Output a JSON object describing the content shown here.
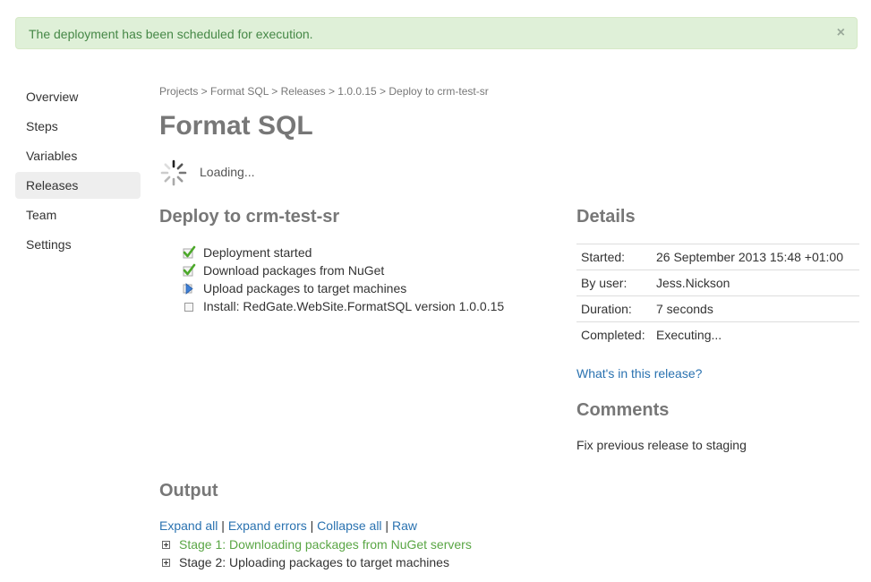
{
  "alert": {
    "message": "The deployment has been scheduled for execution.",
    "close": "×"
  },
  "sidebar": {
    "items": [
      {
        "label": "Overview",
        "active": false
      },
      {
        "label": "Steps",
        "active": false
      },
      {
        "label": "Variables",
        "active": false
      },
      {
        "label": "Releases",
        "active": true
      },
      {
        "label": "Team",
        "active": false
      },
      {
        "label": "Settings",
        "active": false
      }
    ]
  },
  "breadcrumb": "Projects > Format SQL > Releases > 1.0.0.15 > Deploy to crm-test-sr",
  "title": "Format SQL",
  "loading": "Loading...",
  "deploy": {
    "heading": "Deploy to crm-test-sr",
    "steps": [
      {
        "icon": "check-icon",
        "label": "Deployment started"
      },
      {
        "icon": "check-icon",
        "label": "Download packages from NuGet"
      },
      {
        "icon": "arrow-right-icon",
        "label": "Upload packages to target machines"
      },
      {
        "icon": "checkbox-icon",
        "label": "Install: RedGate.WebSite.FormatSQL version 1.0.0.15"
      }
    ]
  },
  "details": {
    "heading": "Details",
    "rows": [
      {
        "key": "Started:",
        "value": "26 September 2013 15:48 +01:00"
      },
      {
        "key": "By user:",
        "value": "Jess.Nickson"
      },
      {
        "key": "Duration:",
        "value": "7 seconds"
      },
      {
        "key": "Completed:",
        "value": "Executing..."
      }
    ],
    "release_link": "What's in this release?"
  },
  "comments": {
    "heading": "Comments",
    "text": "Fix previous release to staging"
  },
  "output": {
    "heading": "Output",
    "expand_all": "Expand all",
    "expand_errors": "Expand errors",
    "collapse_all": "Collapse all",
    "raw": "Raw",
    "separator": " | ",
    "stages": [
      {
        "label": "Stage 1: Downloading packages from NuGet servers",
        "status": "complete"
      },
      {
        "label": "Stage 2: Uploading packages to target machines",
        "status": "running"
      }
    ]
  },
  "colors": {
    "alert_bg": "#dff0d8",
    "alert_text": "#468847",
    "link": "#2a72b0",
    "heading": "#777777",
    "stage_complete": "#5aa645"
  }
}
